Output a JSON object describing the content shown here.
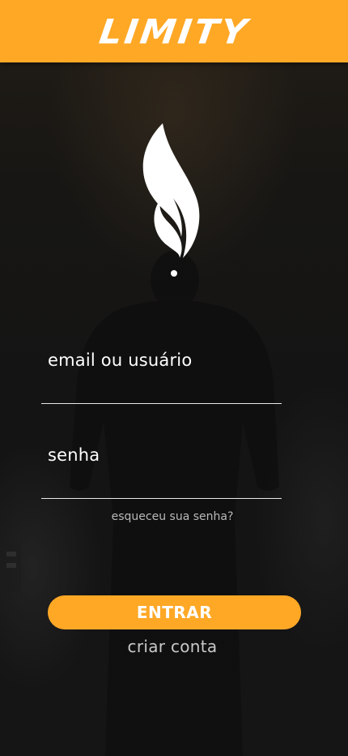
{
  "header": {
    "brand": "LIMITY",
    "color": "#ffa826"
  },
  "logo": {
    "icon": "flame-icon",
    "color": "#ffffff"
  },
  "form": {
    "email_placeholder": "email ou usuário",
    "password_placeholder": "senha",
    "forgot_password": "esqueceu sua senha?"
  },
  "actions": {
    "enter_label": "ENTRAR",
    "create_account": "criar conta"
  },
  "colors": {
    "accent": "#ffa826",
    "background": "#141414",
    "text": "#ffffff"
  }
}
